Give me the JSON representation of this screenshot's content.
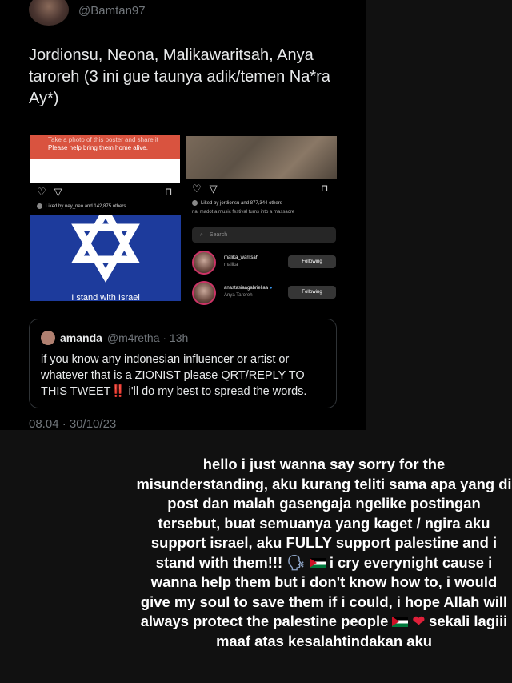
{
  "tweet": {
    "handle": "@Bamtan97",
    "text": "Jordionsu, Neona, Malikawaritsah, Anya taroreh (3 ini gue taunya adik/temen Na*ra Ay*)",
    "timestamp": "08.04 · 30/10/23"
  },
  "instagram": {
    "poster_text_faint": "Take a photo of this poster and share it",
    "poster_text": "Please help bring them home alive.",
    "liked_left": "Liked by ney_neo and 142,875 others",
    "liked_right": "Liked by jordionsu and 877,344 others",
    "caption_right": "nal madot a music festival turns into a massacre",
    "flag_caption": "I stand with Israel",
    "search_placeholder": "Search",
    "users": [
      {
        "username": "malika_waritsah",
        "name": "malika",
        "button": "Following"
      },
      {
        "username": "anastasiaagabriellaa",
        "name": "Anya Taroreh",
        "button": "Following"
      }
    ]
  },
  "quote": {
    "name": "amanda",
    "meta": "@m4retha · 13h",
    "text_before": "if you know any indonesian influencer or artist or whatever that is a ZIONIST please QRT/REPLY TO THIS TWEET",
    "emphasis": "‼️",
    "text_after": " i'll do my best to spread the words."
  },
  "story": {
    "line1": "hello i just wanna say sorry for the misunderstanding, aku kurang teliti sama apa yang di post dan malah gasengaja ngelike postingan tersebut, buat semuanya yang kaget / ngira aku support israel, aku FULLY support palestine and i stand with them!!!",
    "line2": " i cry everynight cause i wanna help them but i don't know how to, i would give my soul to save them if i could, i hope Allah will always protect the palestine people",
    "line3": "sekali lagiii maaf atas kesalahtindakan aku"
  },
  "colors": {
    "background": "#111111",
    "twitter_muted": "#71767b",
    "poster_red": "#d9533f",
    "flag_blue": "#1d3b9c"
  }
}
